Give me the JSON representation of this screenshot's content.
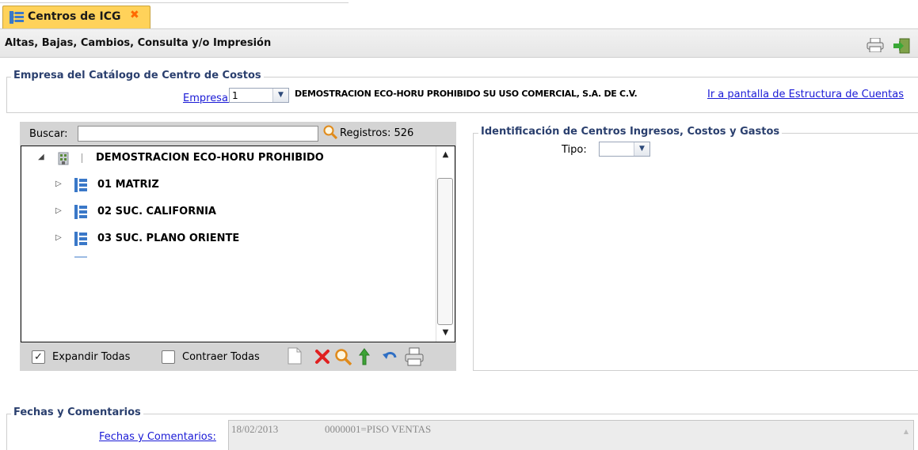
{
  "tab": {
    "label": "Centros de ICG",
    "close_symbol": "✖"
  },
  "titlebar": {
    "title": "Altas, Bajas, Cambios, Consulta y/o Impresión"
  },
  "empresa_section": {
    "legend": "Empresa del Catálogo de Centro de Costos",
    "empresa_label": "Empresa:",
    "empresa_value": "1",
    "empresa_name": "DEMOSTRACION ECO-HORU PROHIBIDO SU USO COMERCIAL, S.A. DE C.V.",
    "structure_link": "Ir a pantalla de Estructura de Cuentas"
  },
  "tree_panel": {
    "search_label": "Buscar:",
    "search_value": "",
    "records_label": "Registros: 526",
    "root": {
      "label": "DEMOSTRACION ECO-HORU PROHIBIDO",
      "expand_symbol": "◢"
    },
    "children": [
      {
        "label": "01 MATRIZ",
        "expand_symbol": "▷"
      },
      {
        "label": "02 SUC. CALIFORNIA",
        "expand_symbol": "▷"
      },
      {
        "label": "03 SUC. PLANO ORIENTE",
        "expand_symbol": "▷"
      }
    ],
    "expand_all_label": "Expandir Todas",
    "expand_all_checked": true,
    "collapse_all_label": "Contraer Todas",
    "collapse_all_checked": false
  },
  "id_section": {
    "legend": "Identificación de Centros Ingresos, Costos y Gastos",
    "tipo_label": "Tipo:",
    "tipo_value": ""
  },
  "fechas_section": {
    "legend": "Fechas y Comentarios",
    "link_label": "Fechas y Comentarios:",
    "date": "18/02/2013",
    "comment": "0000001=PISO  VENTAS"
  },
  "colors": {
    "tab_bg": "#ffd25a",
    "legend_text": "#2a3f6e",
    "link": "#1a1ad6",
    "delete_red": "#e02020",
    "up_green": "#3da336"
  },
  "icons": {
    "tab_icon": "tree-structure-icon",
    "printer": "printer-icon",
    "exit": "exit-door-icon",
    "search": "magnifier-icon",
    "root_node": "building-icon",
    "child_node": "tree-structure-icon",
    "toolbar": [
      "new-document-icon",
      "delete-icon",
      "search-icon",
      "move-up-icon",
      "undo-icon",
      "print-icon"
    ]
  }
}
